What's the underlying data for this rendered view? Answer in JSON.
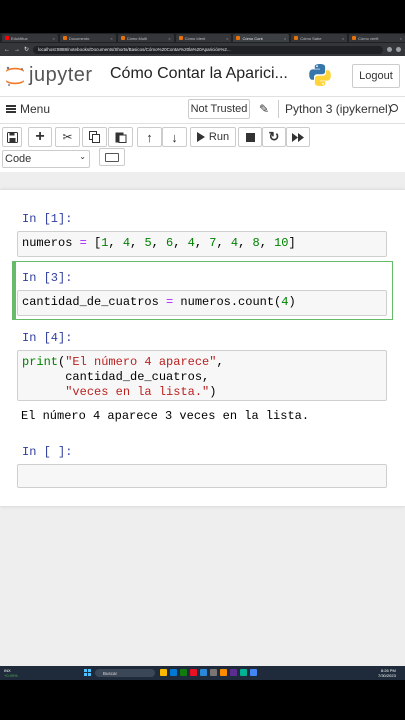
{
  "browser": {
    "tabs": [
      {
        "label": "EduMitux",
        "color": "#ff0000"
      },
      {
        "label": "Documento",
        "color": "#e8710a"
      },
      {
        "label": "Cómo Multi",
        "color": "#e8710a"
      },
      {
        "label": "Cómo Ident",
        "color": "#e8710a"
      },
      {
        "label": "Cómo Cont",
        "color": "#e8710a"
      },
      {
        "label": "Cómo Sabe",
        "color": "#e8710a"
      },
      {
        "label": "Cómo verifi",
        "color": "#e8710a"
      }
    ],
    "url": "localhost:8888/notebooks/Documents/Shorts/Basicos/Cómo%20Contar%20la%20Aparición%2..."
  },
  "header": {
    "logo_text": "jupyter",
    "notebook_title": "Cómo Contar la Aparici...",
    "logout_label": "Logout"
  },
  "menubar": {
    "menu_label": "Menu",
    "trust_label": "Not Trusted",
    "kernel_label": "Python 3 (ipykernel)"
  },
  "toolbar": {
    "run_label": "Run",
    "cell_type": "Code"
  },
  "cells": [
    {
      "prompt": "In [1]:",
      "code": "numeros = [1, 4, 5, 6, 4, 7, 4, 8, 10]"
    },
    {
      "prompt": "In [3]:",
      "code": "cantidad_de_cuatros = numeros.count(4)"
    },
    {
      "prompt": "In [4]:",
      "code_line1": "print(\"El número 4 aparece\",",
      "code_line2": "      cantidad_de_cuatros,",
      "code_line3": "      \"veces en la lista.\")",
      "output": "El número 4 aparece 3 veces en la lista."
    },
    {
      "prompt": "In [ ]:",
      "code": ""
    }
  ],
  "taskbar": {
    "weather_line1": "INX",
    "weather_line2": "+0.99%",
    "search_placeholder": "Buscar",
    "time": "8:26 PM",
    "date": "7/30/2023"
  }
}
